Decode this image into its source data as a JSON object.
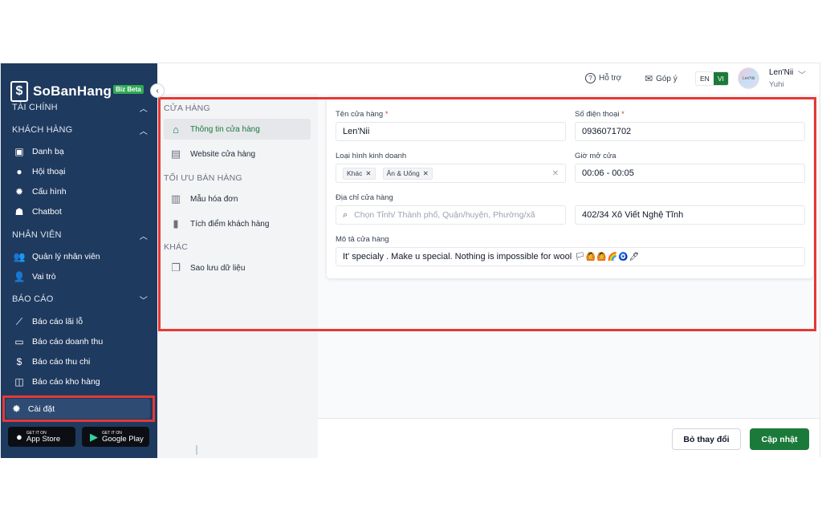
{
  "brand": {
    "name": "SoBanHang",
    "badge": "Biz Beta"
  },
  "sidebar": {
    "sections": [
      {
        "label": "TÀI CHÍNH"
      },
      {
        "label": "KHÁCH HÀNG"
      },
      {
        "label": "NHÂN VIÊN"
      },
      {
        "label": "BÁO CÁO"
      }
    ],
    "items": [
      {
        "label": "Danh bạ",
        "icon": "contacts-icon"
      },
      {
        "label": "Hội thoại",
        "icon": "chat-icon"
      },
      {
        "label": "Cấu hình",
        "icon": "gear-icon"
      },
      {
        "label": "Chatbot",
        "icon": "robot-icon"
      },
      {
        "label": "Quản lý nhân viên",
        "icon": "users-icon"
      },
      {
        "label": "Vai trò",
        "icon": "user-role-icon"
      },
      {
        "label": "Báo cáo lãi lỗ",
        "icon": "line-chart-icon"
      },
      {
        "label": "Báo cáo doanh thu",
        "icon": "cash-icon"
      },
      {
        "label": "Báo cáo thu chi",
        "icon": "coins-icon"
      },
      {
        "label": "Báo cáo kho hàng",
        "icon": "box-icon"
      }
    ],
    "settings_label": "Cài đặt",
    "stores": [
      {
        "small": "GET IT ON",
        "label": "App Store"
      },
      {
        "small": "GET IT ON",
        "label": "Google Play"
      }
    ]
  },
  "header": {
    "support": "Hỗ trợ",
    "feedback": "Góp ý",
    "lang_en": "EN",
    "lang_vi": "VI",
    "avatar_text": "Len'Nii",
    "user_name": "Len'Nii",
    "user_sub": "Yuhi"
  },
  "submenu": {
    "sections": [
      {
        "label": "CỬA HÀNG"
      },
      {
        "label": "TỐI ƯU BÁN HÀNG"
      },
      {
        "label": "KHÁC"
      }
    ],
    "items": [
      {
        "label": "Thông tin cửa hàng",
        "icon": "store-icon"
      },
      {
        "label": "Website cửa hàng",
        "icon": "website-icon"
      },
      {
        "label": "Mẫu hóa đơn",
        "icon": "invoice-icon"
      },
      {
        "label": "Tích điểm khách hàng",
        "icon": "bookmark-icon"
      },
      {
        "label": "Sao lưu dữ liệu",
        "icon": "backup-icon"
      }
    ]
  },
  "form": {
    "store_name": {
      "label": "Tên cửa hàng",
      "value": "Len'Nii"
    },
    "phone": {
      "label": "Số điện thoại",
      "value": "0936071702"
    },
    "business_type": {
      "label": "Loại hình kinh doanh",
      "tags": [
        "Khác",
        "Ăn & Uống"
      ]
    },
    "opening_hours": {
      "label": "Giờ mở cửa",
      "value": "00:06 - 00:05"
    },
    "address": {
      "label": "Địa chỉ cửa hàng",
      "placeholder": "Chọn Tỉnh/ Thành phố, Quận/huyện, Phường/xã",
      "street": "402/34 Xô Viết Nghệ Tĩnh"
    },
    "description": {
      "label": "Mô tả cửa hàng",
      "value": "It' specialy . Make u special. Nothing is impossible for wool",
      "emoji": "🏳🙆🙆🌈🧿🖊"
    }
  },
  "footer": {
    "cancel_label": "Bỏ thay đổi",
    "save_label": "Cập nhật"
  },
  "colors": {
    "sidebar": "#1f3a5f",
    "accent": "#1b7a3a",
    "highlight": "#e53935"
  }
}
